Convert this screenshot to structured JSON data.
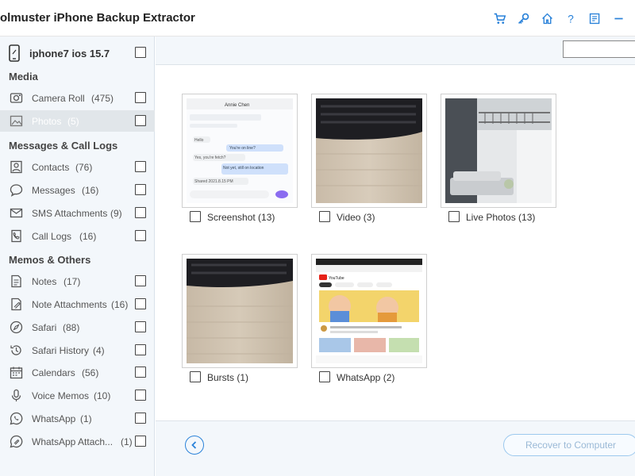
{
  "app": {
    "title": "olmuster iPhone Backup Extractor"
  },
  "titlebar_icons": [
    "cart-icon",
    "key-icon",
    "home-icon",
    "help-icon",
    "feedback-icon",
    "minimize-icon"
  ],
  "titlebar_help_glyph": "?",
  "device": {
    "name": "iphone7 ios 15.7"
  },
  "sections": {
    "media": "Media",
    "messages": "Messages & Call Logs",
    "memos": "Memos & Others"
  },
  "nav": {
    "camera_roll": {
      "label": "Camera Roll",
      "count": "(475)"
    },
    "photos": {
      "label": "Photos",
      "count": "(5)"
    },
    "contacts": {
      "label": "Contacts",
      "count": "(76)"
    },
    "messages": {
      "label": "Messages",
      "count": "(16)"
    },
    "sms_attachments": {
      "label": "SMS Attachments",
      "count": "(9)"
    },
    "call_logs": {
      "label": "Call Logs",
      "count": "(16)"
    },
    "notes": {
      "label": "Notes",
      "count": "(17)"
    },
    "note_attachments": {
      "label": "Note Attachments",
      "count": "(16)"
    },
    "safari": {
      "label": "Safari",
      "count": "(88)"
    },
    "safari_history": {
      "label": "Safari History",
      "count": "(4)"
    },
    "calendars": {
      "label": "Calendars",
      "count": "(56)"
    },
    "voice_memos": {
      "label": "Voice Memos",
      "count": "(10)"
    },
    "whatsapp": {
      "label": "WhatsApp",
      "count": "(1)"
    },
    "whatsapp_attach": {
      "label": "WhatsApp Attach...",
      "count": "(1)"
    }
  },
  "albums": {
    "screenshot": "Screenshot (13)",
    "video": "Video (3)",
    "live_photos": "Live Photos (13)",
    "bursts": "Bursts (1)",
    "whatsapp": "WhatsApp (2)"
  },
  "thumb_text": {
    "chat_name": "Annie Chen",
    "chat_lines": [
      "Hello",
      "You're on line?",
      "Yes, you're fetch?",
      "Not yet, still on location",
      "Shared 2021.8.15 PM"
    ],
    "yt_brand": "YouTube"
  },
  "footer": {
    "recover_label": "Recover to Computer"
  },
  "colors": {
    "accent": "#2a82d9",
    "sidebar_bg": "#f3f7fb",
    "selected_bg": "#e1e6ea",
    "recover_text": "#9ab9d6"
  }
}
